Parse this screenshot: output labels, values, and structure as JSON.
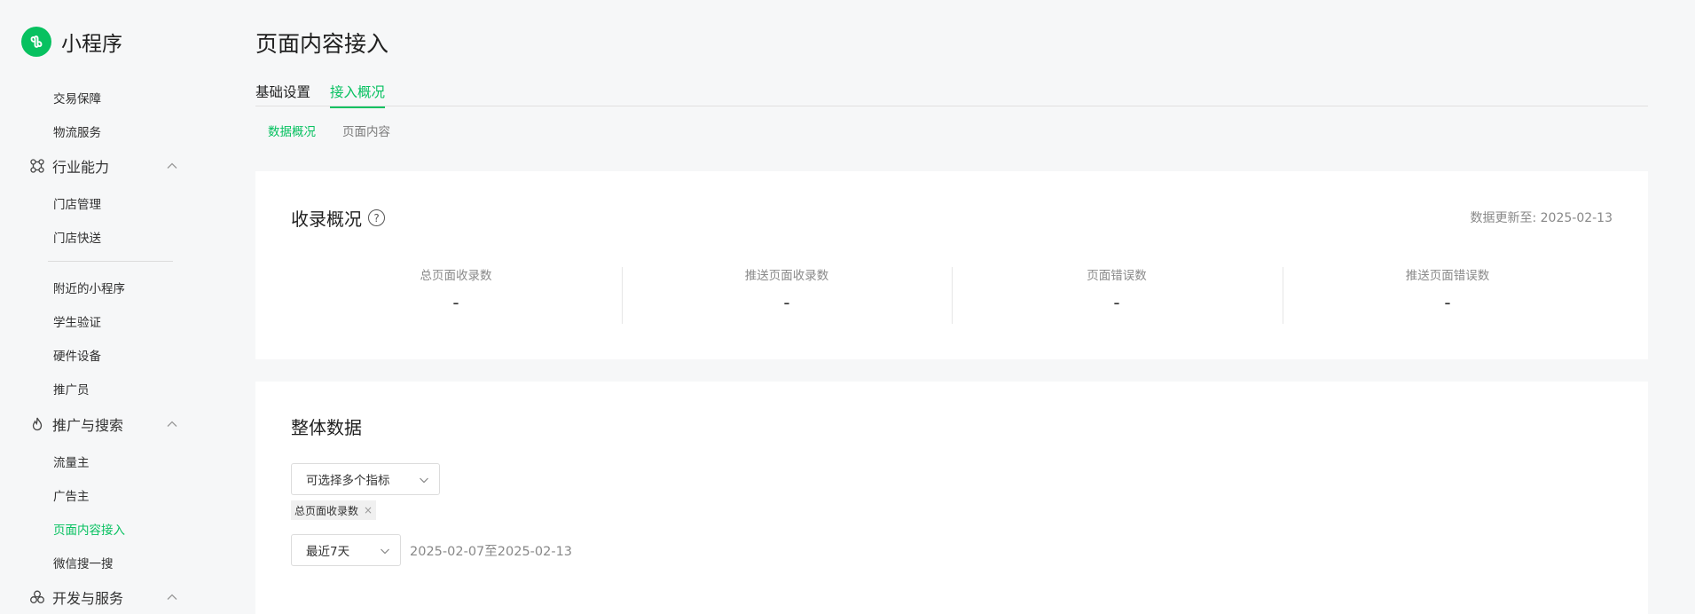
{
  "app": {
    "title": "小程序",
    "brand_color": "#07c160",
    "logo_icon": "miniprogram-logo"
  },
  "sidebar": {
    "items_top": [
      {
        "label": "交易保障"
      },
      {
        "label": "物流服务"
      }
    ],
    "groups": [
      {
        "label": "行业能力",
        "icon": "industry-icon",
        "items": [
          {
            "label": "门店管理"
          },
          {
            "label": "门店快送"
          }
        ]
      },
      {
        "items_after_divider": [
          {
            "label": "附近的小程序"
          },
          {
            "label": "学生验证"
          },
          {
            "label": "硬件设备"
          },
          {
            "label": "推广员"
          }
        ]
      },
      {
        "label": "推广与搜索",
        "icon": "promotion-icon",
        "items": [
          {
            "label": "流量主"
          },
          {
            "label": "广告主"
          },
          {
            "label": "页面内容接入",
            "active": true
          },
          {
            "label": "微信搜一搜"
          }
        ]
      },
      {
        "label": "开发与服务",
        "icon": "dev-service-icon"
      }
    ]
  },
  "main": {
    "title": "页面内容接入",
    "tabs": [
      {
        "label": "基础设置"
      },
      {
        "label": "接入概况",
        "active": true
      }
    ],
    "subtabs": [
      {
        "label": "数据概况",
        "active": true
      },
      {
        "label": "页面内容"
      }
    ],
    "overview": {
      "title": "收录概况",
      "help": "?",
      "update_note": "数据更新至: 2025-02-13",
      "metrics": [
        {
          "label": "总页面收录数",
          "value": "-"
        },
        {
          "label": "推送页面收录数",
          "value": "-"
        },
        {
          "label": "页面错误数",
          "value": "-"
        },
        {
          "label": "推送页面错误数",
          "value": "-"
        }
      ]
    },
    "overall": {
      "title": "整体数据",
      "metric_select_placeholder": "可选择多个指标",
      "selected_tags": [
        {
          "label": "总页面收录数",
          "close": "×"
        }
      ],
      "period_select": "最近7天",
      "date_range": "2025-02-07至2025-02-13"
    }
  }
}
